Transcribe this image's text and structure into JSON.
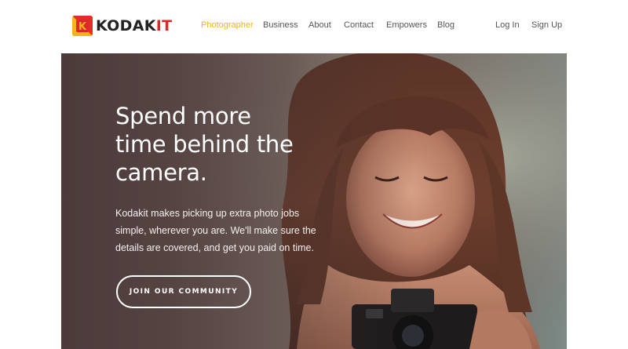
{
  "brand": {
    "name_left": "KODAK",
    "name_right": "IT",
    "logo_icon": "kodak-k-logo-icon",
    "colors": {
      "logo_yellow": "#f3b41b",
      "logo_red": "#e0262b",
      "nav_active": "#f2b21c"
    }
  },
  "nav": {
    "items": [
      {
        "label": "Photographer",
        "active": true
      },
      {
        "label": "Business",
        "active": false
      },
      {
        "label": "About",
        "active": false
      },
      {
        "label": "Contact",
        "active": false
      },
      {
        "label": "Empowers",
        "active": false
      },
      {
        "label": "Blog",
        "active": false
      }
    ],
    "auth": {
      "login": "Log In",
      "signup": "Sign Up"
    }
  },
  "hero": {
    "headline": [
      "Spend more",
      "time behind the",
      "camera."
    ],
    "subcopy": [
      "Kodakit makes picking up extra photo jobs",
      "simple, wherever you are. We'll make sure the",
      "details are covered, and get you paid on time."
    ],
    "cta_label": "JOIN OUR COMMUNITY"
  }
}
